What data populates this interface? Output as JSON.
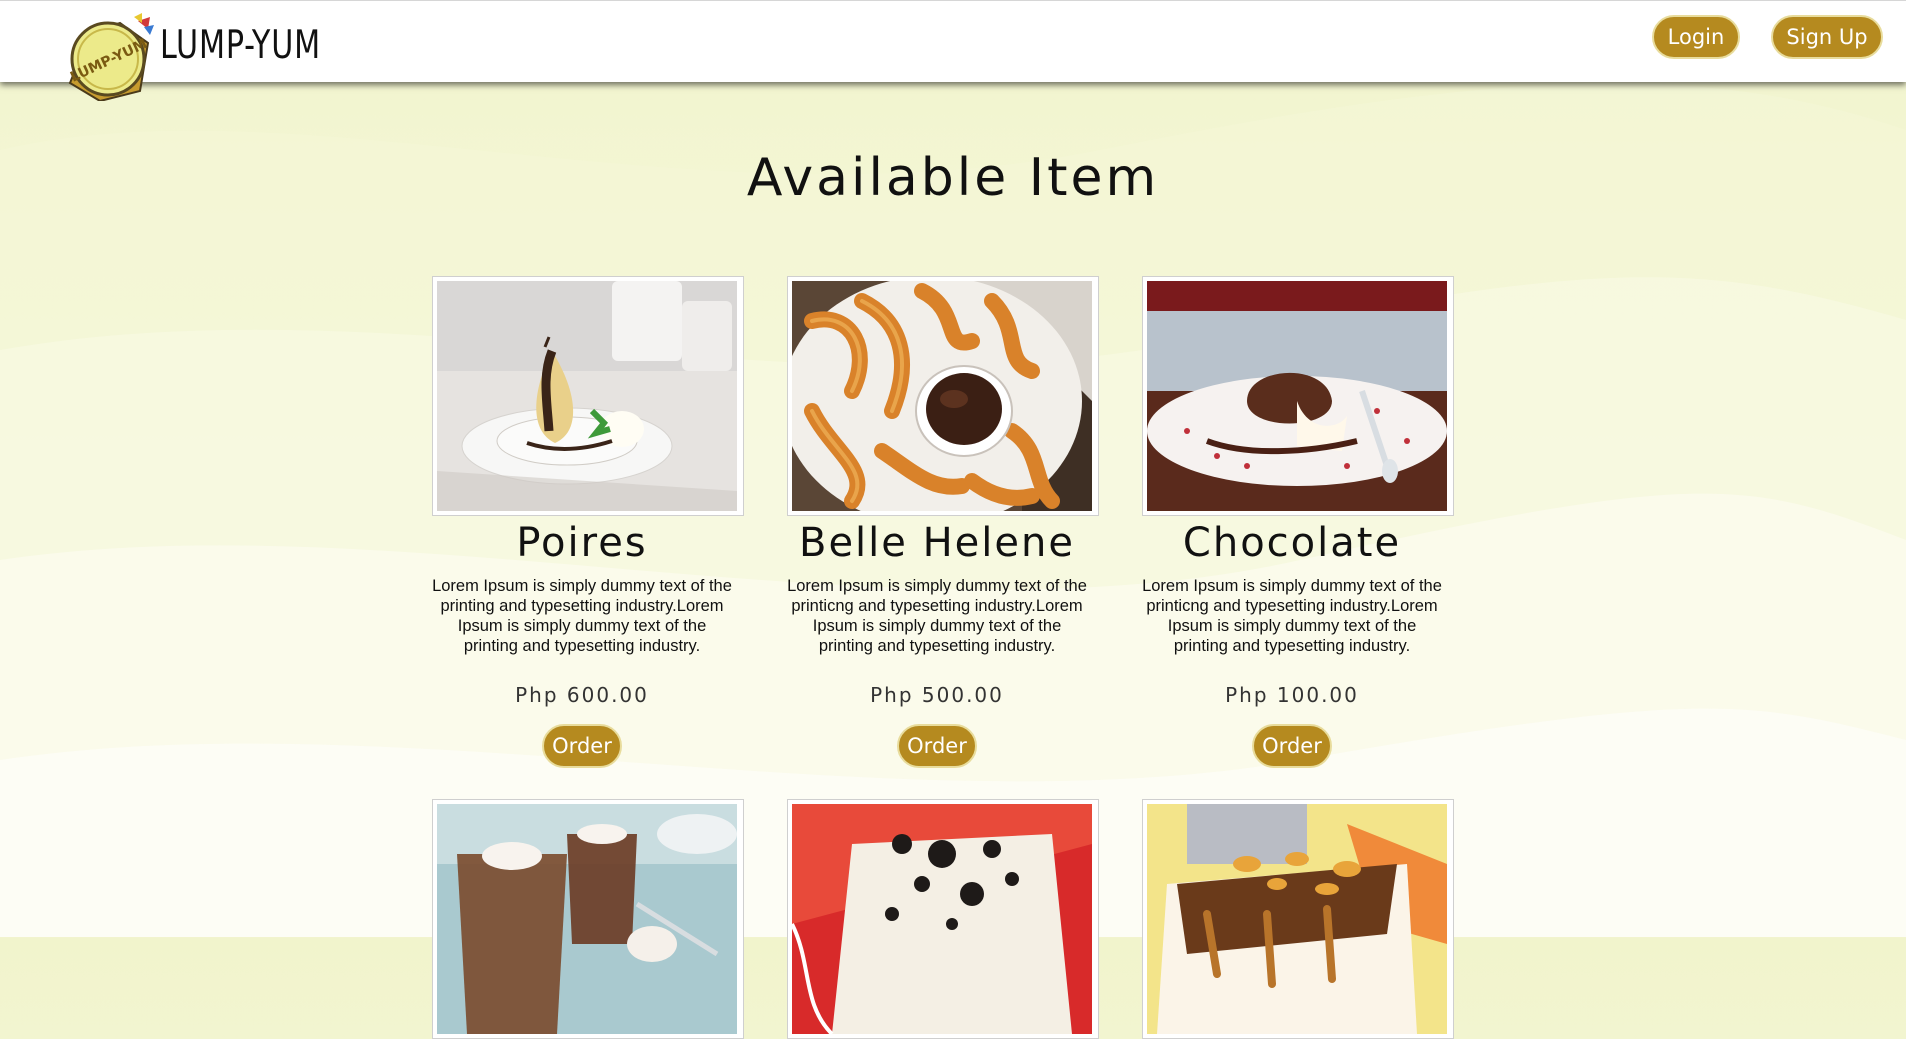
{
  "header": {
    "brand": "LUMP-YUM",
    "logo_text": "LUMP-YUM",
    "login_label": "Login",
    "signup_label": "Sign Up"
  },
  "main": {
    "title": "Available Item",
    "items": [
      {
        "name": "Poires",
        "description": "Lorem Ipsum is simply dummy text of the printing and typesetting industry.Lorem Ipsum is simply dummy text of the printing and typesetting industry.",
        "price": "Php 600.00",
        "order_label": "Order",
        "image": "poached-pear-dessert"
      },
      {
        "name": "Belle Helene",
        "description": "Lorem Ipsum is simply dummy text of the printicng and typesetting industry.Lorem Ipsum is simply dummy text of the printing and typesetting industry.",
        "price": "Php 500.00",
        "order_label": "Order",
        "image": "churros-with-chocolate"
      },
      {
        "name": "Chocolate",
        "description": "Lorem Ipsum is simply dummy text of the printicng and typesetting industry.Lorem Ipsum is simply dummy text of the printing and typesetting industry.",
        "price": "Php 100.00",
        "order_label": "Order",
        "image": "chocolate-lava-cake"
      }
    ],
    "more_items": [
      {
        "image": "chocolate-mousse-cups"
      },
      {
        "image": "cookies-and-cream-cake"
      },
      {
        "image": "caramel-nut-cheesecake"
      }
    ]
  },
  "colors": {
    "accent": "#b58a1f",
    "button_border": "#e8dc9c",
    "background": "#f3f5d2"
  }
}
